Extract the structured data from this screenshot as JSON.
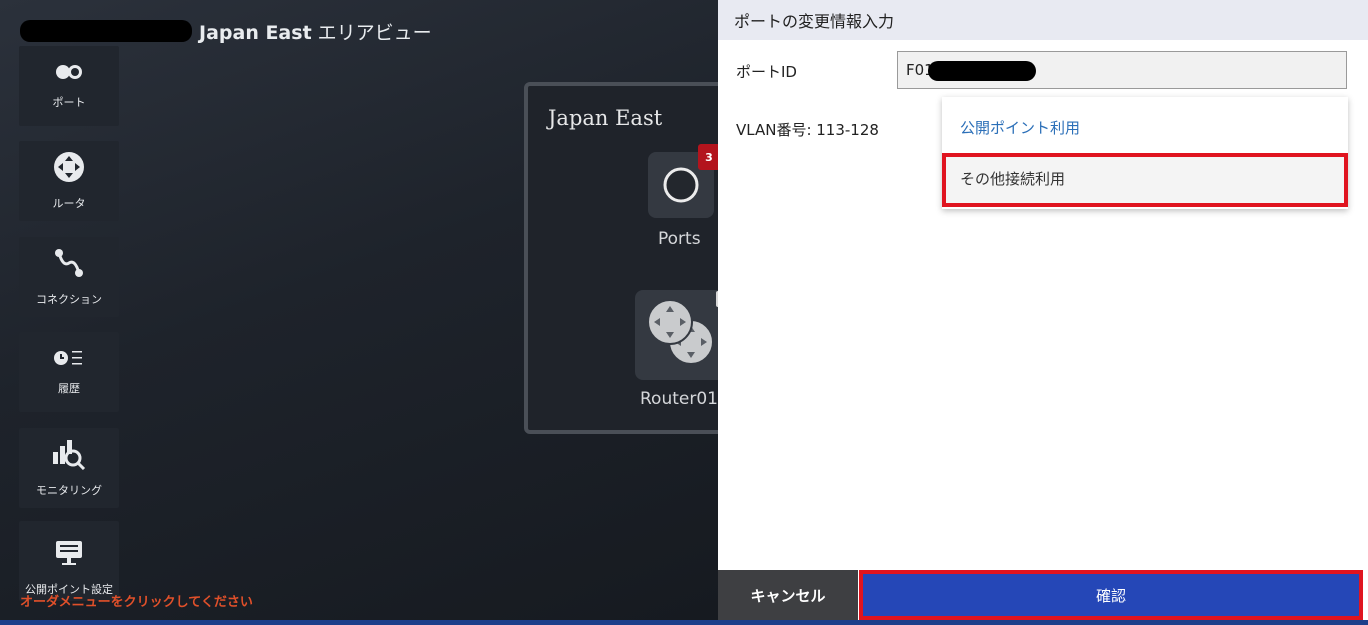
{
  "header": {
    "area_name": "Japan East",
    "view_suffix": "エリアビュー"
  },
  "sidebar": {
    "items": [
      {
        "label": "ポート",
        "icon": "port-icon"
      },
      {
        "label": "ルータ",
        "icon": "router-icon"
      },
      {
        "label": "コネクション",
        "icon": "connection-icon"
      },
      {
        "label": "履歴",
        "icon": "history-icon"
      },
      {
        "label": "モニタリング",
        "icon": "monitoring-icon"
      },
      {
        "label": "公開ポイント設定",
        "icon": "public-point-icon"
      }
    ],
    "order_menu": "オーダメニューをクリックしてください"
  },
  "canvas": {
    "area_title": "Japan East",
    "ports_label": "Ports",
    "ports_badge": "3",
    "router_label": "Router01"
  },
  "panel": {
    "title": "ポートの変更情報入力",
    "port_id_label": "ポートID",
    "port_id_value": "F01",
    "vlan_label": "VLAN番号: 113-128",
    "dropdown_options": [
      "公開ポイント利用",
      "その他接続利用"
    ],
    "cancel_label": "キャンセル",
    "confirm_label": "確認"
  },
  "colors": {
    "accent": "#2547b7",
    "highlight": "#e0141f",
    "warning_text": "#e0502a",
    "link": "#2b6fb8"
  }
}
